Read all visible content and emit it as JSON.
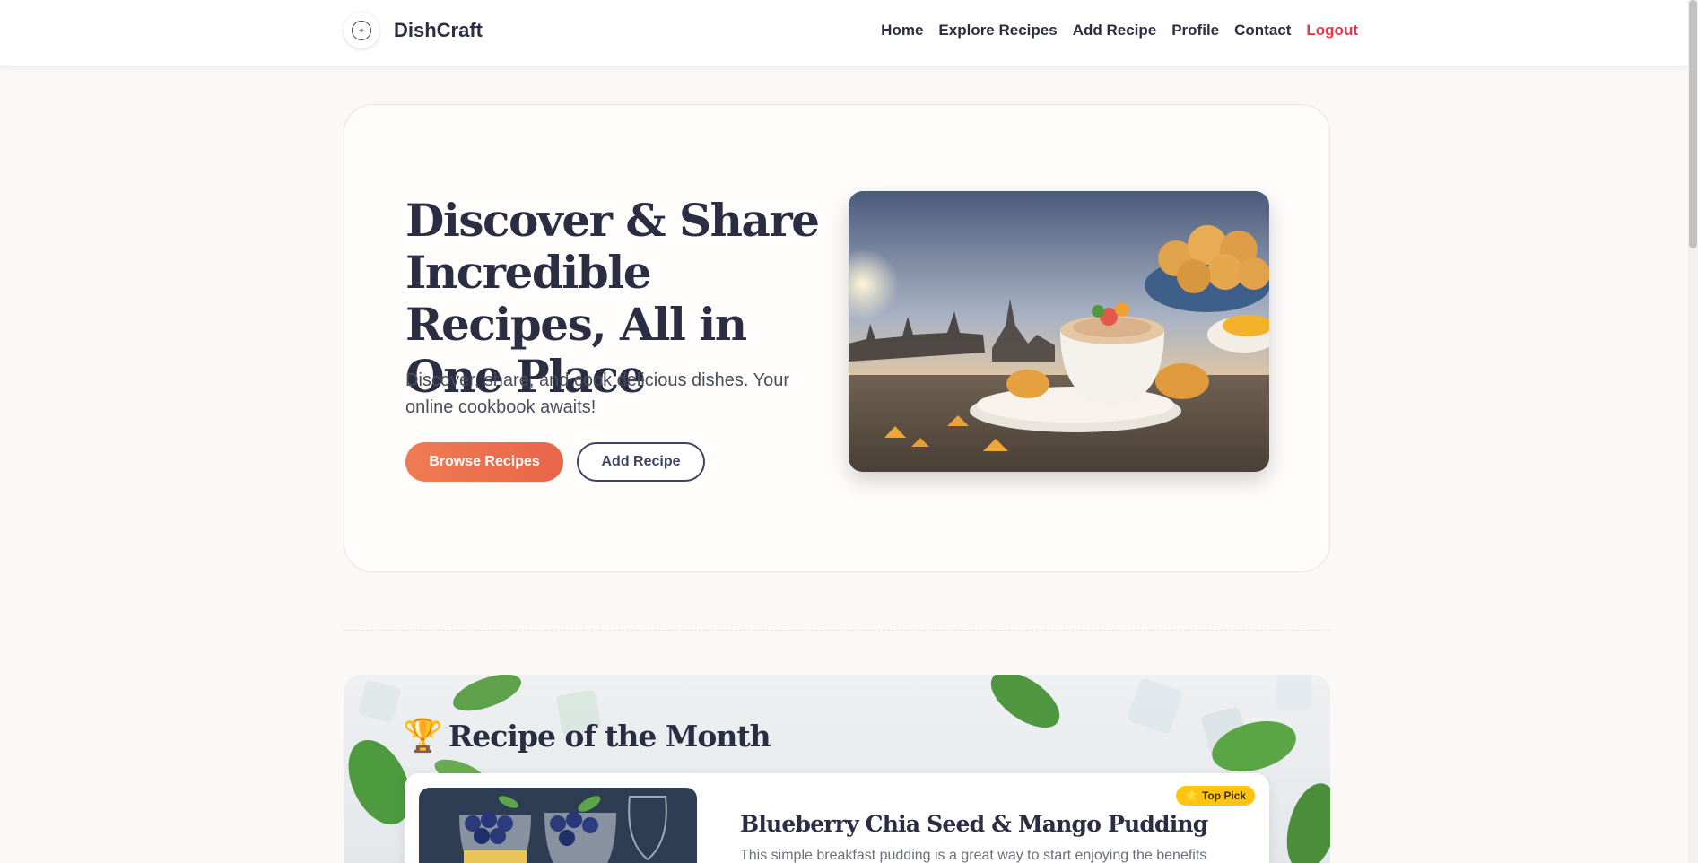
{
  "nav": {
    "brand": "DishCraft",
    "links": [
      "Home",
      "Explore Recipes",
      "Add Recipe",
      "Profile",
      "Contact"
    ],
    "logout": "Logout"
  },
  "hero": {
    "title": "Discover & Share Incredible Recipes, All in One Place",
    "subtitle": "Discover, share, and cook delicious dishes. Your online cookbook awaits!",
    "primary_button": "Browse Recipes",
    "secondary_button": "Add Recipe"
  },
  "recipe_of_month": {
    "heading": "Recipe of the Month",
    "badge": "Top Pick",
    "title": "Blueberry Chia Seed & Mango Pudding",
    "description": "This simple breakfast pudding is a great way to start enjoying the benefits"
  },
  "icons": {
    "trophy": "trophy-icon",
    "star": "star-icon"
  },
  "colors": {
    "accent": "#ef7b52",
    "logout": "#e63946",
    "badge": "#ffc412",
    "text": "#2b2d42"
  }
}
